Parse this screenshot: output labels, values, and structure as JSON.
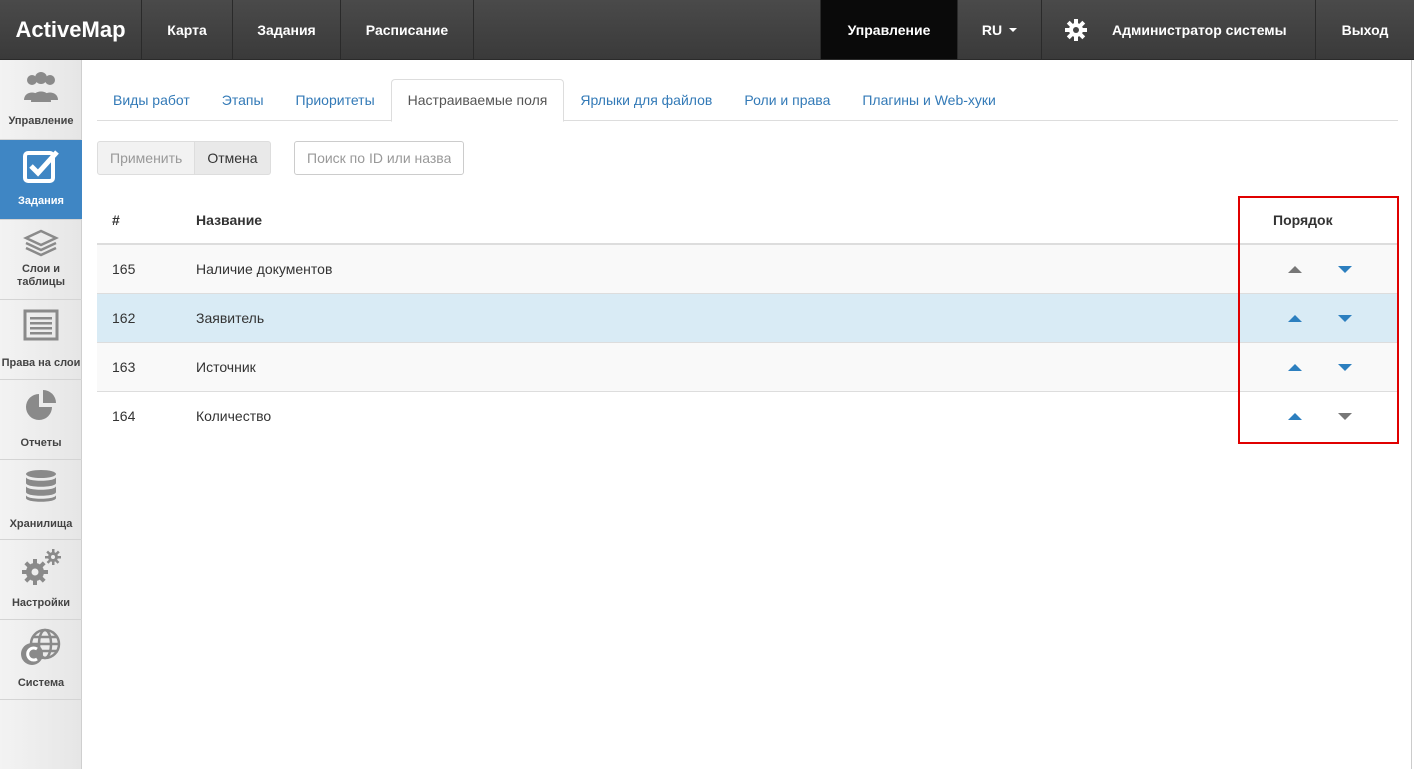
{
  "brand": "ActiveMap",
  "nav": {
    "items": [
      "Карта",
      "Задания",
      "Расписание"
    ],
    "active_item": "Управление",
    "language": "RU",
    "user": "Администратор системы",
    "logout": "Выход"
  },
  "sidebar": {
    "items": [
      {
        "label": "Управление",
        "icon": "users-icon"
      },
      {
        "label": "Задания",
        "icon": "checkbox-icon",
        "active": true
      },
      {
        "label": "Слои и таблицы",
        "icon": "layers-icon"
      },
      {
        "label": "Права на слои",
        "icon": "list-icon"
      },
      {
        "label": "Отчеты",
        "icon": "pie-chart-icon"
      },
      {
        "label": "Хранилища",
        "icon": "database-icon"
      },
      {
        "label": "Настройки",
        "icon": "gears-icon"
      },
      {
        "label": "Система",
        "icon": "globe-icon"
      }
    ]
  },
  "tabs": [
    "Виды работ",
    "Этапы",
    "Приоритеты",
    "Настраиваемые поля",
    "Ярлыки для файлов",
    "Роли и права",
    "Плагины и Web-хуки"
  ],
  "active_tab": "Настраиваемые поля",
  "toolbar": {
    "apply": "Применить",
    "cancel": "Отмена"
  },
  "search": {
    "placeholder": "Поиск по ID или назва"
  },
  "table": {
    "columns": {
      "id": "#",
      "name": "Название",
      "order": "Порядок"
    },
    "rows": [
      {
        "id": "165",
        "name": "Наличие документов"
      },
      {
        "id": "162",
        "name": "Заявитель"
      },
      {
        "id": "163",
        "name": "Источник"
      },
      {
        "id": "164",
        "name": "Количество"
      }
    ]
  },
  "colors": {
    "accent": "#3f86c4",
    "link": "#337ab7",
    "selected_row": "#d9ebf5",
    "highlight_border": "#e00000",
    "arrow_active": "#2c7fbf",
    "arrow_disabled": "#777777"
  }
}
